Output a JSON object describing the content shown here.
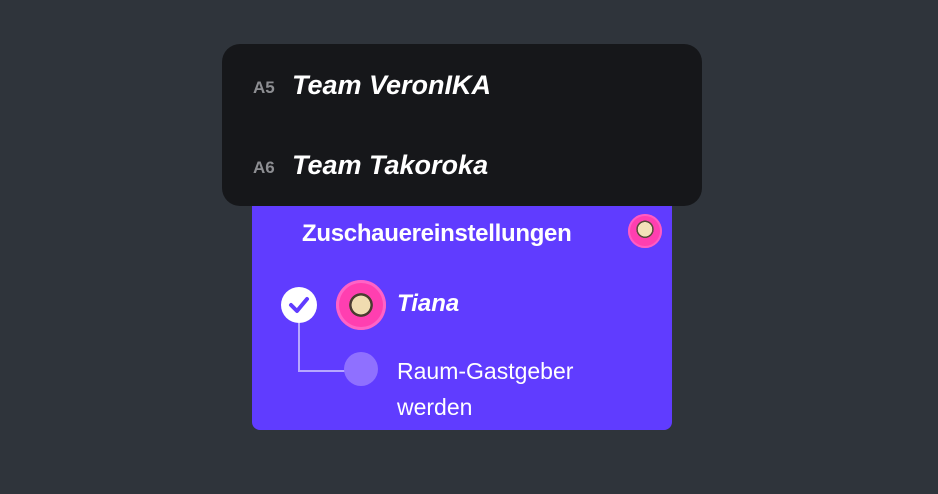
{
  "dropdown": {
    "teams": [
      {
        "code": "A5",
        "name": "Team VeronIKA"
      },
      {
        "code": "A6",
        "name": "Team Takoroka"
      }
    ]
  },
  "settings": {
    "title": "Zuschauereinstellungen",
    "user": {
      "name": "Tiana",
      "checked": true
    },
    "host_option": "Raum-Gastgeber werden"
  },
  "colors": {
    "background": "#2f343b",
    "panel": "#603cff",
    "dropdown": "#16171a",
    "avatar_pink": "#ff3fb0"
  },
  "icons": {
    "check": "checkmark-icon",
    "avatar": "avatar-icon"
  }
}
